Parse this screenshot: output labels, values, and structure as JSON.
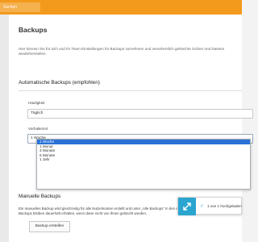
{
  "header": {
    "search_placeholder": "Suchen"
  },
  "page": {
    "title": "Backups",
    "intro": "Hier können Sie für sich und Ihr Team Einstellungen für Backups vornehmen und versehentlich gelöschte Ordner und Dateien wiederherstellen."
  },
  "auto_backup": {
    "heading": "Automatische Backups (empfohlen)",
    "frequency_label": "Häufigkeit",
    "frequency_value": "Täglich",
    "retention_label": "Vorhaltezeit",
    "retention_value": "1 Woche",
    "options": [
      "1 Woche",
      "1 Monat",
      "3 Monate",
      "6 Monate",
      "1 Jahr"
    ],
    "selected_index": 0
  },
  "manual_backup": {
    "heading": "Manuelle Backups",
    "text": "Ein manuelles Backup wird gleichzeitig für alle Nutzerkonten erstellt und unter „Alle Backups\" in den einzelnen Konten ab Manuelle Backups bleiben dauerhaft erhalten, wenn diese nicht von Ihnen gelöscht werden.",
    "button_label": "Backup erstellen"
  },
  "toast": {
    "text": "1 von 1 hochgeladen"
  },
  "colors": {
    "accent_orange": "#f39a1c",
    "selection_blue": "#2a72d6",
    "toast_teal": "#2aa5cf"
  }
}
